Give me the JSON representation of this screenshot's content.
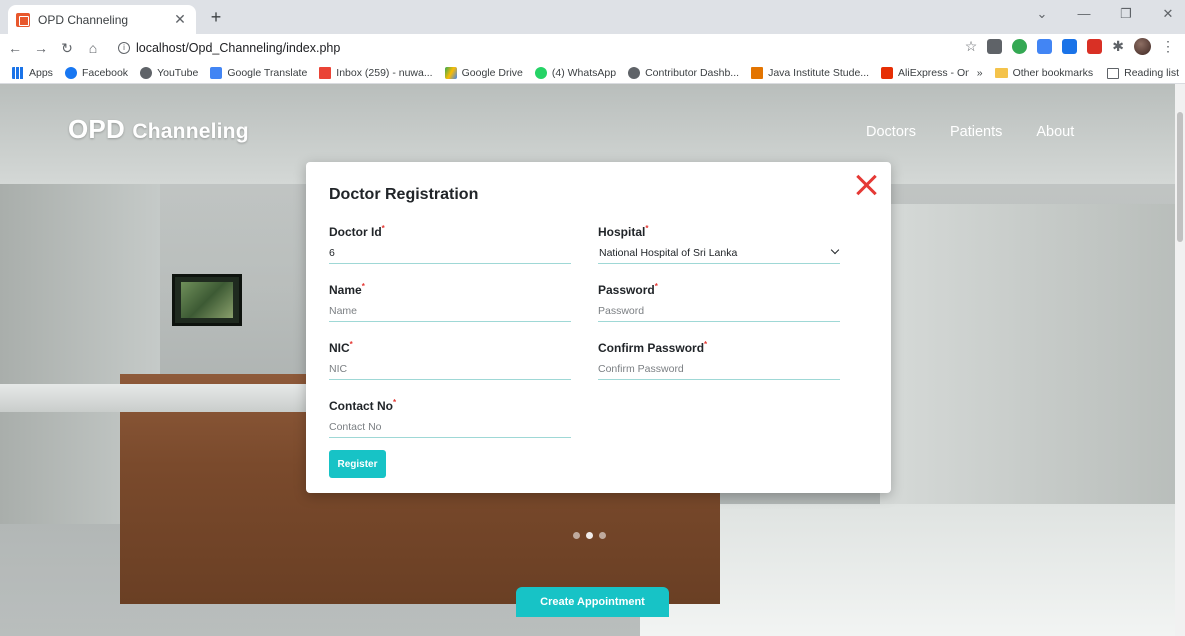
{
  "browser": {
    "tab_title": "OPD Channeling",
    "url": "localhost/Opd_Channeling/index.php",
    "bookmarks": [
      "Apps",
      "Facebook",
      "YouTube",
      "Google Translate",
      "Inbox (259) - nuwa...",
      "Google Drive",
      "(4) WhatsApp",
      "Contributor Dashb...",
      "Java Institute Stude...",
      "AliExpress - Online..."
    ],
    "other_bookmarks": "Other bookmarks",
    "reading_list": "Reading list",
    "overflow": "»"
  },
  "site": {
    "brand_main": "OPD",
    "brand_sub": "Channeling",
    "nav": [
      "Doctors",
      "Patients",
      "About"
    ],
    "cta": "Create Appointment"
  },
  "modal": {
    "title": "Doctor Registration",
    "required_mark": "*",
    "fields": {
      "doctor_id": {
        "label": "Doctor Id",
        "value": "6"
      },
      "name": {
        "label": "Name",
        "placeholder": "Name"
      },
      "nic": {
        "label": "NIC",
        "placeholder": "NIC"
      },
      "contact": {
        "label": "Contact No",
        "placeholder": "Contact No"
      },
      "hospital": {
        "label": "Hospital",
        "value": "National Hospital of Sri Lanka"
      },
      "password": {
        "label": "Password",
        "placeholder": "Password"
      },
      "confirm_password": {
        "label": "Confirm Password",
        "placeholder": "Confirm Password"
      }
    },
    "register_label": "Register"
  },
  "colors": {
    "accent": "#17c3c6",
    "required": "#e53935",
    "close": "#e53935"
  }
}
